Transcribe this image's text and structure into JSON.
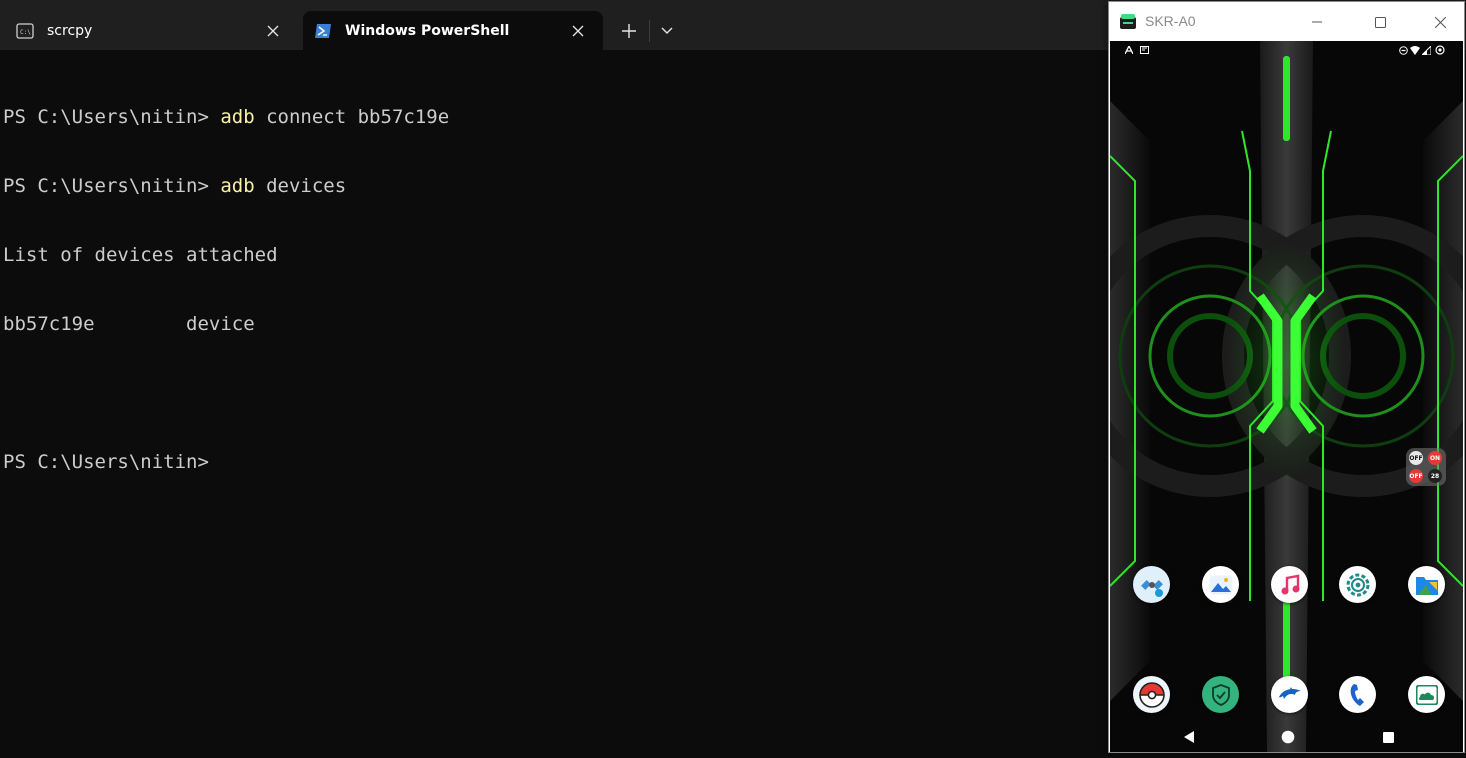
{
  "terminal": {
    "tabs": [
      {
        "label": "scrcpy",
        "icon": "cmd-icon",
        "active": false
      },
      {
        "label": "Windows PowerShell",
        "icon": "powershell-icon",
        "active": true
      }
    ],
    "new_tab_icon": "plus-icon",
    "dropdown_icon": "chevron-down-icon",
    "lines": [
      {
        "prompt": "PS C:\\Users\\nitin> ",
        "cmd": "adb",
        "args": " connect bb57c19e"
      },
      {
        "prompt": "PS C:\\Users\\nitin> ",
        "cmd": "adb",
        "args": " devices"
      },
      {
        "text": "List of devices attached"
      },
      {
        "text": "bb57c19e        device"
      },
      {
        "text": ""
      },
      {
        "prompt": "PS C:\\Users\\nitin> ",
        "cmd": "",
        "args": ""
      }
    ],
    "colors": {
      "background": "#0c0c0c",
      "text": "#cccccc",
      "command": "#f9f1a5",
      "tabbar": "#1f1f1f"
    }
  },
  "scrcpy_window": {
    "title": "SKR-A0",
    "controls": [
      "minimize-icon",
      "maximize-icon",
      "close-icon"
    ],
    "status_bar": {
      "left_icons": [
        "a-notification-icon",
        "n-notification-icon"
      ],
      "right_icons": [
        "dnd-icon",
        "wifi-icon",
        "signal-icon",
        "battery-icon"
      ]
    },
    "home_row_1": [
      {
        "name": "satellite-app-icon"
      },
      {
        "name": "gallery-app-icon"
      },
      {
        "name": "music-app-icon"
      },
      {
        "name": "settings-app-icon"
      },
      {
        "name": "files-app-icon"
      }
    ],
    "home_row_2": [
      {
        "name": "pokeball-app-icon"
      },
      {
        "name": "shield-app-icon"
      },
      {
        "name": "dolphin-app-icon"
      },
      {
        "name": "phone-app-icon"
      },
      {
        "name": "cloud-app-icon"
      }
    ],
    "floating_widget_labels": [
      "OFF",
      "ON",
      "OFF",
      "28"
    ],
    "nav_buttons": [
      "back-icon",
      "home-icon",
      "recents-icon"
    ],
    "colors": {
      "accent_green": "#2fe62a",
      "screen_bg": "#070707"
    }
  }
}
